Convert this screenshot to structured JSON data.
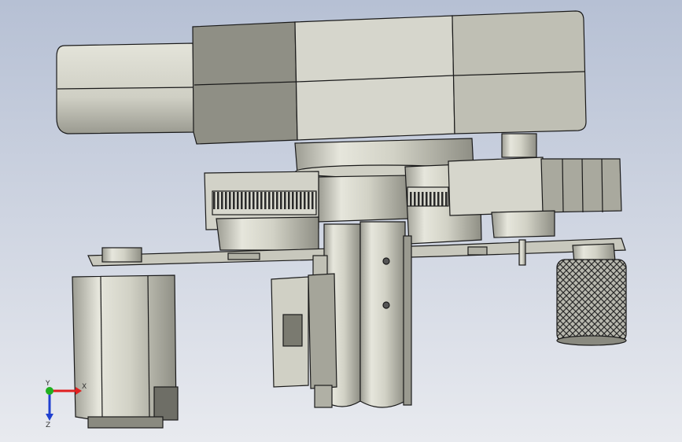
{
  "scene": {
    "background_top": "#b9c3d6",
    "background_bottom": "#e6e9ef",
    "part_light": "#dcdcd2",
    "part_mid": "#c4c4b8",
    "part_dark": "#8a8a80",
    "edge": "#1a1a1a"
  },
  "triad": {
    "x_label": "X",
    "y_label": "Y",
    "z_label": "Z",
    "x_color": "#e02020",
    "y_color": "#20b020",
    "z_color": "#2040d0"
  }
}
